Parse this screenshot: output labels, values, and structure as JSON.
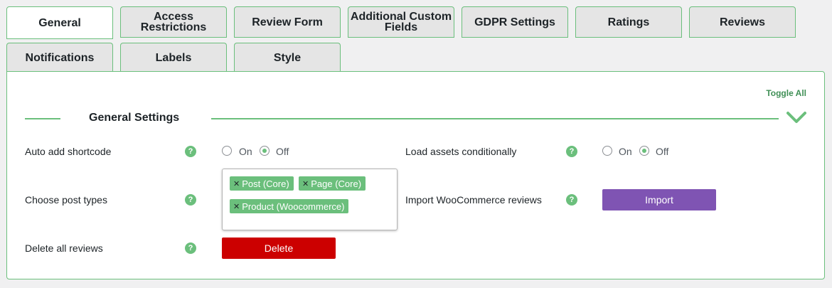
{
  "tabs": [
    {
      "label": "General"
    },
    {
      "label": "Access Restrictions"
    },
    {
      "label": "Review Form"
    },
    {
      "label": "Additional Custom Fields"
    },
    {
      "label": "GDPR Settings"
    },
    {
      "label": "Ratings"
    },
    {
      "label": "Reviews"
    },
    {
      "label": "Notifications"
    },
    {
      "label": "Labels"
    },
    {
      "label": "Style"
    }
  ],
  "panel": {
    "toggle_all": "Toggle All",
    "section_title": "General Settings"
  },
  "settings": {
    "auto_add_shortcode": {
      "label": "Auto add shortcode",
      "on": "On",
      "off": "Off",
      "selected": "Off"
    },
    "load_assets": {
      "label": "Load assets conditionally",
      "on": "On",
      "off": "Off",
      "selected": "Off"
    },
    "post_types": {
      "label": "Choose post types",
      "chips": [
        "Post (Core)",
        "Page (Core)",
        "Product (Woocommerce)"
      ]
    },
    "import_reviews": {
      "label": "Import WooCommerce reviews",
      "button": "Import"
    },
    "delete_reviews": {
      "label": "Delete all reviews",
      "button": "Delete"
    },
    "help_glyph": "?"
  },
  "colors": {
    "accent_green": "#6bbf7c",
    "import_purple": "#7f54b3",
    "delete_red": "#cc0000"
  }
}
